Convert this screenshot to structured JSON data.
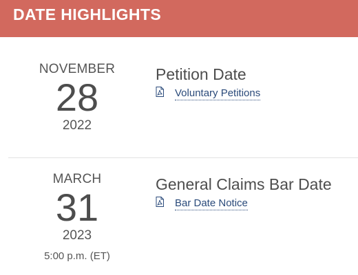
{
  "header": {
    "title": "DATE HIGHLIGHTS"
  },
  "entries": [
    {
      "month": "NOVEMBER",
      "day": "28",
      "year": "2022",
      "time": "",
      "event_title": "Petition Date",
      "link_icon": "pdf-icon",
      "link_text": "Voluntary Petitions"
    },
    {
      "month": "MARCH",
      "day": "31",
      "year": "2023",
      "time": "5:00 p.m. (ET)",
      "event_title": "General Claims Bar Date",
      "link_icon": "pdf-icon",
      "link_text": "Bar Date Notice"
    }
  ],
  "colors": {
    "header_bg": "#d2695e",
    "link": "#2a4a7a",
    "text": "#4d4d4d"
  }
}
